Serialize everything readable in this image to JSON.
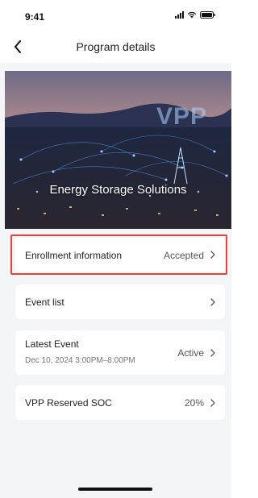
{
  "status_bar": {
    "time": "9:41"
  },
  "nav": {
    "title": "Program details"
  },
  "banner": {
    "title": "Energy Storage Solutions",
    "watermark": "VPP"
  },
  "cards": {
    "enrollment": {
      "label": "Enrollment information",
      "value": "Accepted"
    },
    "event_list": {
      "label": "Event list"
    },
    "latest_event": {
      "label": "Latest Event",
      "sub": "Dec 10, 2024 3:00PM–8:00PM",
      "value": "Active"
    },
    "reserved_soc": {
      "label": "VPP Reserved SOC",
      "value": "20%"
    }
  },
  "colors": {
    "highlight": "#e8413d",
    "background": "#f4f5f7"
  }
}
